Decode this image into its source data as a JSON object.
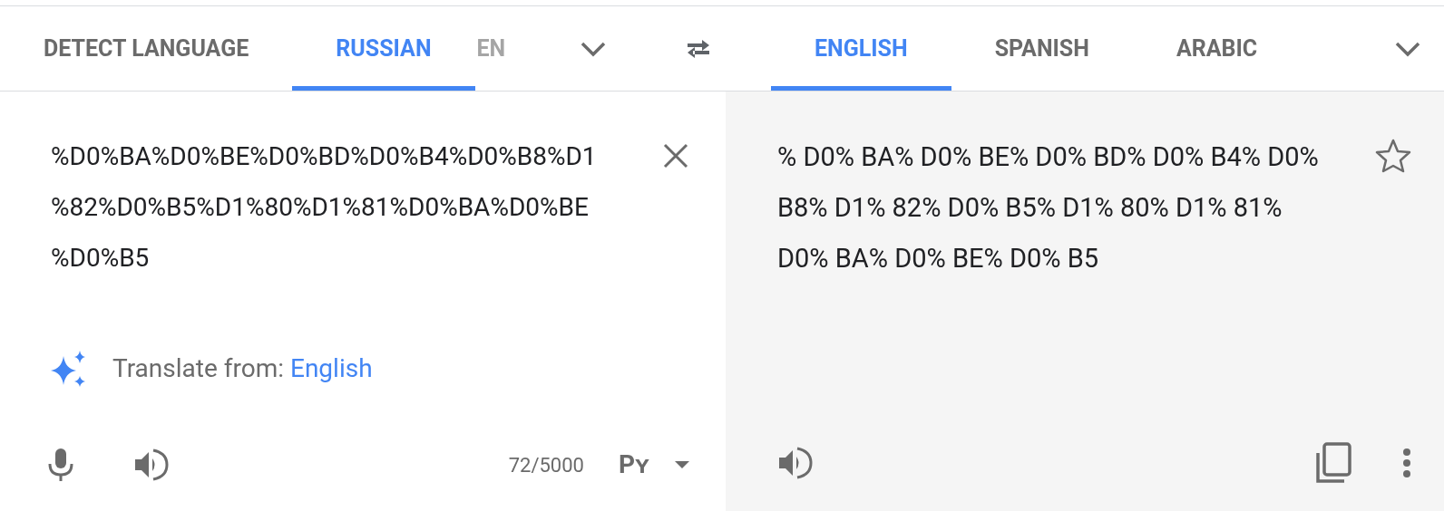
{
  "source_tabs": [
    {
      "label": "DETECT LANGUAGE",
      "selected": false
    },
    {
      "label": "RUSSIAN",
      "selected": true
    },
    {
      "label": "EN",
      "selected": false
    }
  ],
  "target_tabs": [
    {
      "label": "ENGLISH",
      "selected": true
    },
    {
      "label": "SPANISH",
      "selected": false
    },
    {
      "label": "ARABIC",
      "selected": false
    }
  ],
  "source": {
    "text": "%D0%BA%D0%BE%D0%BD%D0%B4%D0%B8%D1%82%D0%B5%D1%80%D1%81%D0%BA%D0%BE%D0%B5",
    "suggestion_label": "Translate from:",
    "suggestion_link": "English",
    "char_count": "72/5000",
    "input_tool": "Рʏ"
  },
  "target": {
    "text": "% D0% BA% D0% BE% D0% BD% D0% B4% D0% B8% D1% 82% D0% B5% D1% 80% D1% 81% D0% BA% D0% BE% D0% B5",
    "starred": false
  }
}
